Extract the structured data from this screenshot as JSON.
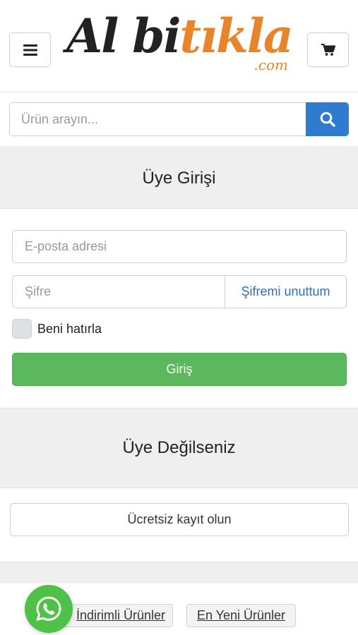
{
  "header": {
    "logo": {
      "part1": "Al bi",
      "part2": "tıkla",
      "suffix": ".com"
    },
    "menu_icon": "hamburger-icon",
    "cart_icon": "shopping-cart-icon"
  },
  "search": {
    "placeholder": "Ürün arayın...",
    "button_icon": "search-icon"
  },
  "login": {
    "title": "Üye Girişi",
    "email_placeholder": "E-posta adresi",
    "password_placeholder": "Şifre",
    "forgot_password": "Şifremi unuttum",
    "remember_me": "Beni hatırla",
    "submit": "Giriş"
  },
  "register": {
    "title": "Üye Değilseniz",
    "button": "Ücretsiz kayıt olun"
  },
  "footer_tags": [
    {
      "label": "İndirimli Ürünler"
    },
    {
      "label": "En Yeni Ürünler"
    }
  ],
  "whatsapp": {
    "icon": "whatsapp-icon"
  },
  "colors": {
    "brand_orange": "#e8852a",
    "search_blue": "#2e7bcf",
    "login_green": "#5cb85c",
    "link_blue": "#2f6fb3",
    "whatsapp_green": "#4dc247"
  }
}
